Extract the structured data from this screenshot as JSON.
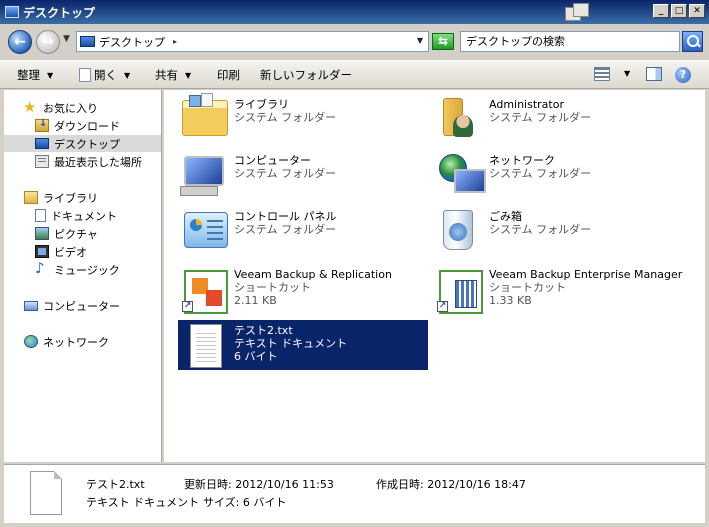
{
  "window": {
    "title": "デスクトップ"
  },
  "address": {
    "location": "デスクトップ"
  },
  "search": {
    "placeholder": "デスクトップの検索"
  },
  "toolbar": {
    "organize": "整理",
    "open": "開く",
    "share": "共有",
    "print": "印刷",
    "new_folder": "新しいフォルダー"
  },
  "nav": {
    "favorites": "お気に入り",
    "downloads": "ダウンロード",
    "desktop": "デスクトップ",
    "recent": "最近表示した場所",
    "libraries": "ライブラリ",
    "documents": "ドキュメント",
    "pictures": "ピクチャ",
    "videos": "ビデオ",
    "music": "ミュージック",
    "computer": "コンピューター",
    "network": "ネットワーク"
  },
  "items": [
    {
      "name": "ライブラリ",
      "type": "システム フォルダー",
      "icon": "library-icon"
    },
    {
      "name": "Administrator",
      "type": "システム フォルダー",
      "icon": "user-folder-icon"
    },
    {
      "name": "コンピューター",
      "type": "システム フォルダー",
      "icon": "computer-icon"
    },
    {
      "name": "ネットワーク",
      "type": "システム フォルダー",
      "icon": "network-icon"
    },
    {
      "name": "コントロール パネル",
      "type": "システム フォルダー",
      "icon": "control-panel-icon"
    },
    {
      "name": "ごみ箱",
      "type": "システム フォルダー",
      "icon": "recycle-bin-icon"
    },
    {
      "name": "Veeam Backup & Replication",
      "type": "ショートカット",
      "size": "2.11 KB",
      "icon": "veeam-br-icon"
    },
    {
      "name": "Veeam Backup Enterprise Manager",
      "type": "ショートカット",
      "size": "1.33 KB",
      "icon": "veeam-em-icon"
    },
    {
      "name": "テスト2.txt",
      "type": "テキスト ドキュメント",
      "size": "6 バイト",
      "icon": "text-file-icon",
      "selected": true
    }
  ],
  "details": {
    "name": "テスト2.txt",
    "type": "テキスト ドキュメント",
    "modified_label": "更新日時:",
    "modified_value": "2012/10/16 11:53",
    "created_label": "作成日時:",
    "created_value": "2012/10/16 18:47",
    "size_label": "サイズ:",
    "size_value": "6 バイト"
  },
  "colors": {
    "selection": "#0a246a",
    "titlebar": "#0a246a"
  }
}
